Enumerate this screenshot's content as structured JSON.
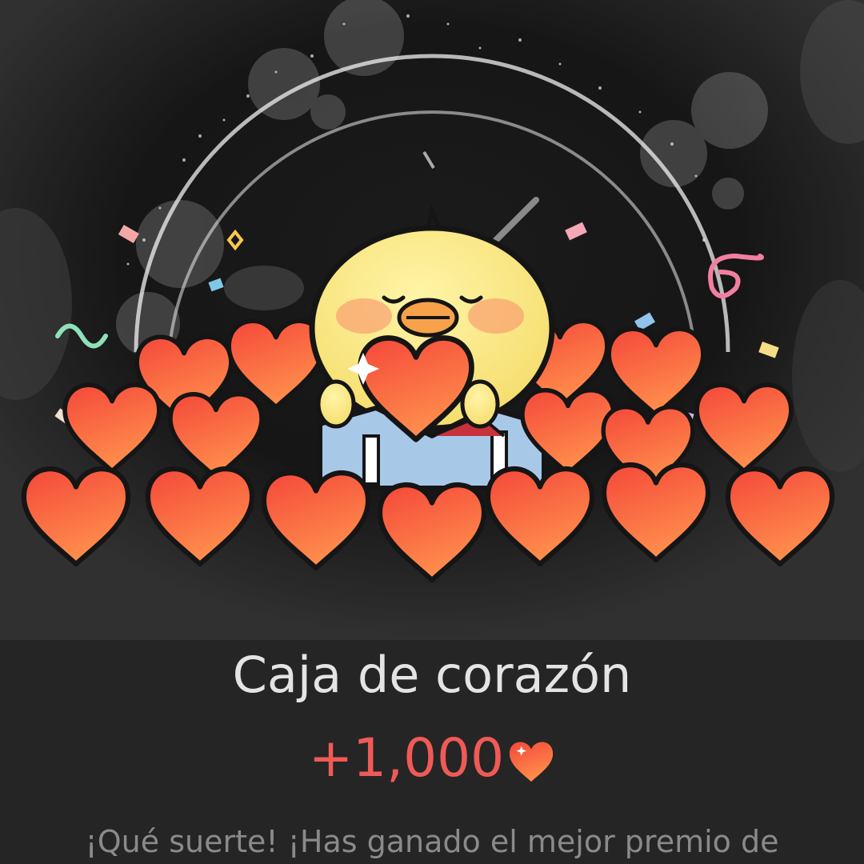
{
  "reward": {
    "title": "Caja de corazón",
    "amount": "+1,000",
    "message": "¡Qué suerte! ¡Has ganado el mejor premio de"
  },
  "icons": {
    "reward_currency": "heart-icon",
    "character": "yellow-chick-character"
  },
  "colors": {
    "background": "#252525",
    "accent": "#ef5a57",
    "title": "#e4e4e4",
    "message": "#8a8a8a"
  }
}
